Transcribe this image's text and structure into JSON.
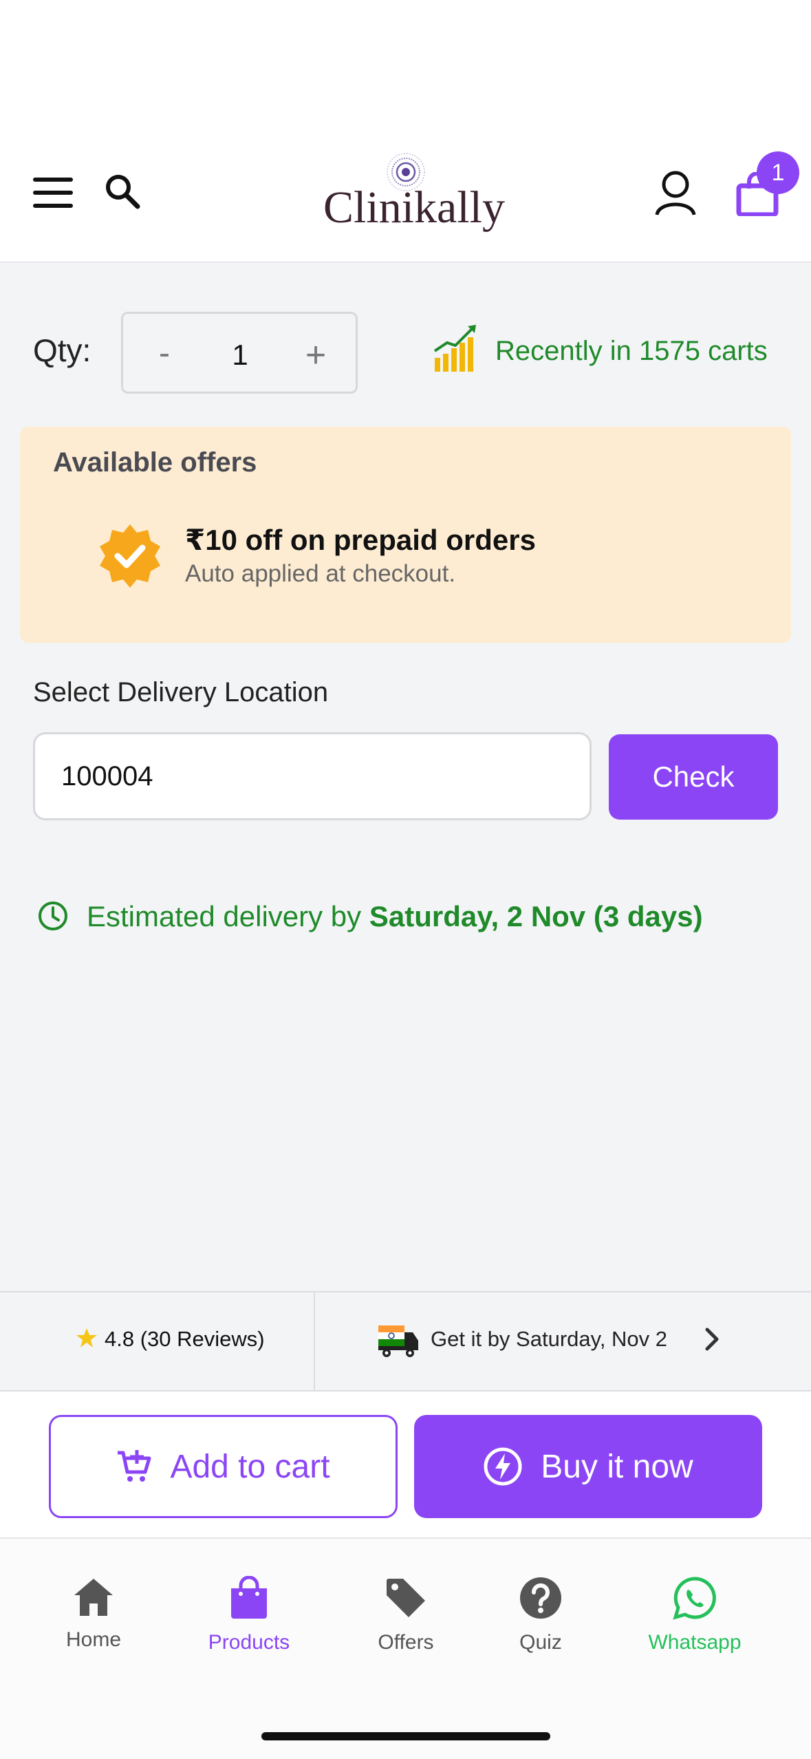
{
  "header": {
    "logo_text": "Clinikally",
    "cart_count": "1"
  },
  "quantity": {
    "label": "Qty:",
    "minus": "-",
    "value": "1",
    "plus": "+"
  },
  "popularity": {
    "text": "Recently in 1575 carts"
  },
  "offers": {
    "title": "Available offers",
    "items": [
      {
        "title": "₹10 off on prepaid orders",
        "subtitle": "Auto applied at checkout."
      }
    ]
  },
  "delivery": {
    "label": "Select Delivery Location",
    "pincode": "100004",
    "check_label": "Check",
    "estimate_prefix": "Estimated delivery by ",
    "estimate_date": "Saturday, 2 Nov (3 days)"
  },
  "info_strip": {
    "rating": "4.8 (30 Reviews)",
    "delivery_text": "Get it by Saturday, Nov 2"
  },
  "actions": {
    "add_to_cart": "Add to cart",
    "buy_now": "Buy it now"
  },
  "tabbar": {
    "items": [
      {
        "label": "Home"
      },
      {
        "label": "Products"
      },
      {
        "label": "Offers"
      },
      {
        "label": "Quiz"
      },
      {
        "label": "Whatsapp"
      }
    ]
  },
  "colors": {
    "accent": "#8b45f5",
    "success": "#1f8a2a",
    "whatsapp": "#25c05a",
    "offer_bg": "#fdecd2"
  }
}
